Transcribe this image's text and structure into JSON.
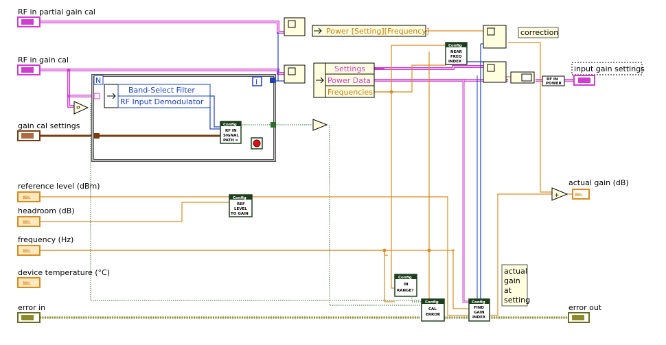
{
  "controls": {
    "rf_partial": "RF in partial gain cal",
    "rf_gain": "RF in gain cal",
    "gain_cal_settings": "gain cal settings",
    "reference_level": "reference level (dBm)",
    "headroom": "headroom (dB)",
    "frequency": "frequency (Hz)",
    "device_temperature": "device temperature (°C)",
    "error_in": "error in"
  },
  "indicators": {
    "input_gain_settings": "input gain settings",
    "actual_gain": "actual gain (dB)",
    "error_out": "error out"
  },
  "terminals": {
    "dbl": "DBL",
    "cluster": "▭"
  },
  "bundle_power": "Power [Setting][Frequency]",
  "unbundle": {
    "settings": "Settings",
    "power_data": "Power Data",
    "frequencies": "Frequencies"
  },
  "case_items": {
    "band_select": "Band-Select Filter",
    "rf_demod": "RF Input Demodulator"
  },
  "subvis": {
    "config": "Config",
    "rf_in_signal_path": [
      "RF IN",
      "SIGNAL",
      "PATH ="
    ],
    "near_freq_index": [
      "NEAR",
      "FREQ",
      "INDEX"
    ],
    "ref_level_to_gain": [
      "REF",
      "LEVEL",
      "TO GAIN"
    ],
    "in_range": [
      "IN",
      "RANGE?"
    ],
    "cal_error": [
      "CAL",
      "ERROR"
    ],
    "find_gain_index": [
      "FIND",
      "GAIN",
      "INDEX"
    ],
    "rf_in_power": [
      "RF IN",
      "POWER"
    ]
  },
  "labels": {
    "correction": "correction",
    "actual_gain_at_setting": [
      "actual",
      "gain",
      "at",
      "setting"
    ],
    "loop_i": "i",
    "case_n": "N"
  },
  "colors": {
    "pink": "#d23ad2",
    "orange": "#d98b1d",
    "brown": "#7a3b12",
    "blue": "#1a3fbf",
    "dark_green": "#1d3f1d",
    "ochre": "#8a8a2a"
  }
}
